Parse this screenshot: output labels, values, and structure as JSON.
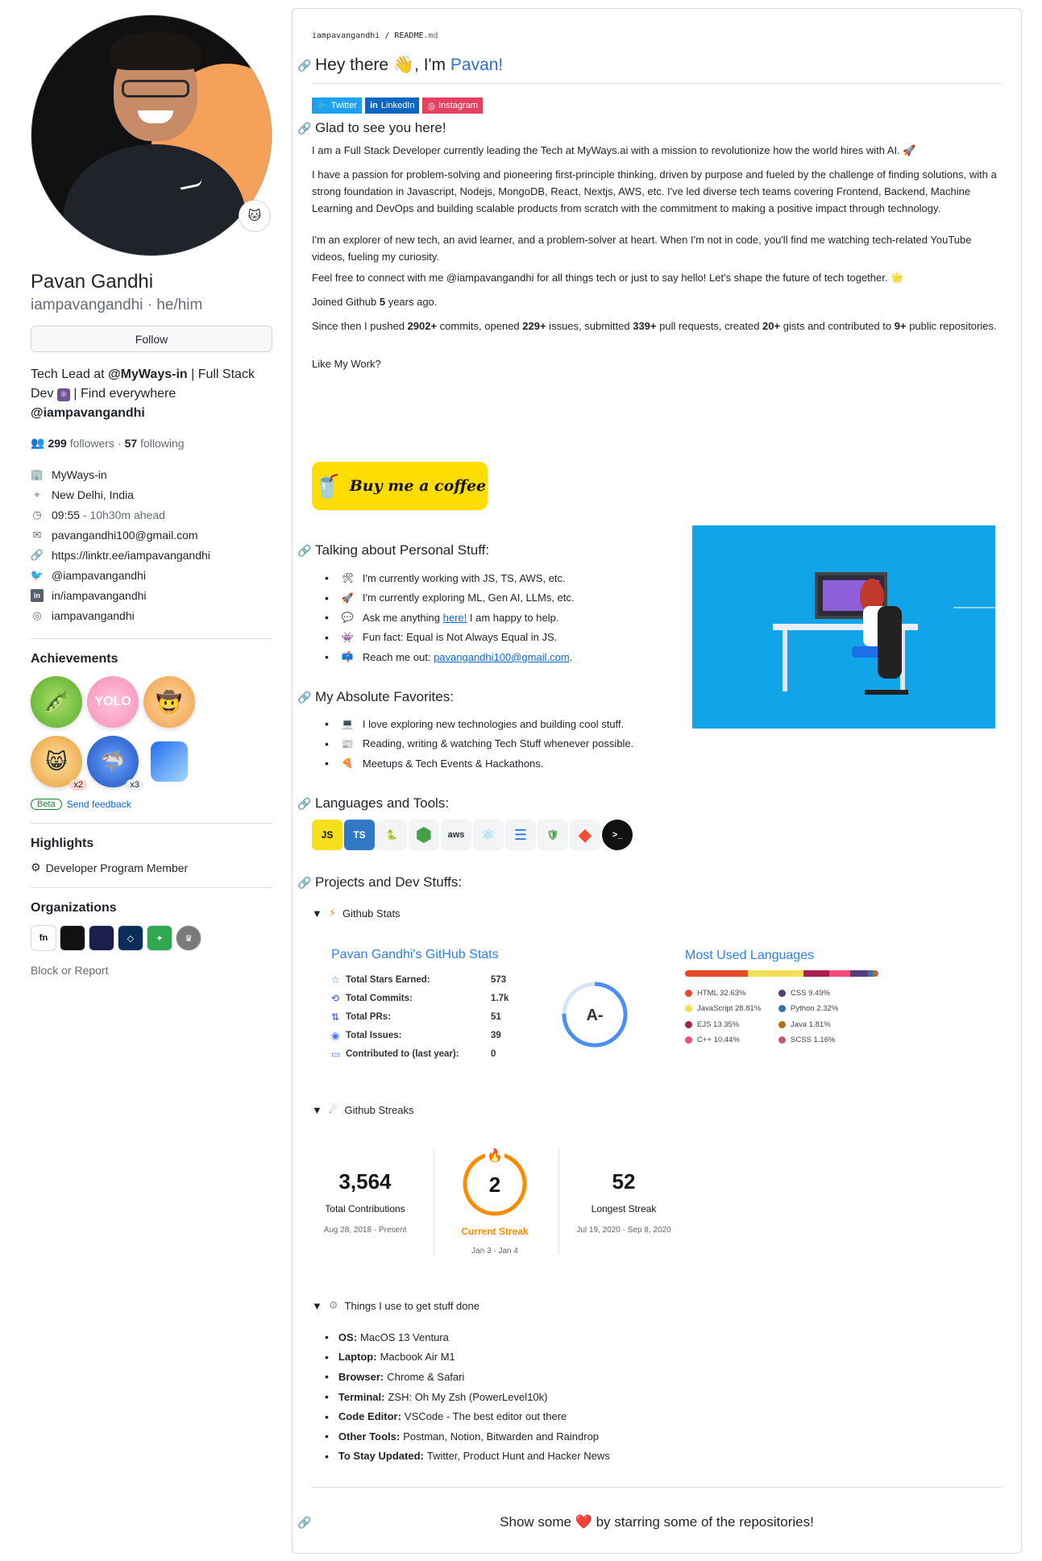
{
  "profile": {
    "name": "Pavan Gandhi",
    "login": "iampavangandhi · he/him",
    "follow_label": "Follow",
    "bio_prefix": "Tech Lead at ",
    "bio_org": "@MyWays-in",
    "bio_mid": " | Full Stack Dev ",
    "bio_mid2": " | Find everywhere ",
    "bio_handle": "@iampavangandhi",
    "followers_count": "299",
    "followers_label": "followers",
    "following_count": "57",
    "following_label": "following",
    "dot": "·",
    "details": [
      {
        "icon": "organization-icon",
        "text": "MyWays-in",
        "muted": ""
      },
      {
        "icon": "location-icon",
        "text": "New Delhi, India",
        "muted": ""
      },
      {
        "icon": "clock-icon",
        "text": "09:55",
        "muted": " - 10h30m ahead"
      },
      {
        "icon": "mail-icon",
        "text": "pavangandhi100@gmail.com",
        "muted": ""
      },
      {
        "icon": "link-icon",
        "text": "https://linktr.ee/iampavangandhi",
        "muted": ""
      },
      {
        "icon": "twitter-icon",
        "text": "@iampavangandhi",
        "muted": ""
      },
      {
        "icon": "linkedin-icon",
        "text": "in/iampavangandhi",
        "muted": ""
      },
      {
        "icon": "instagram-icon",
        "text": "iampavangandhi",
        "muted": ""
      }
    ],
    "achievements_title": "Achievements",
    "achievement_counts": {
      "a4": "x2",
      "a5": "x3"
    },
    "beta_label": "Beta",
    "feedback_label": "Send feedback",
    "highlights_title": "Highlights",
    "highlight_item": "Developer Program Member",
    "orgs_title": "Organizations",
    "block_label": "Block or Report"
  },
  "readme": {
    "crumb_user": "iampavangandhi",
    "crumb_sep": " / ",
    "crumb_file": "README",
    "crumb_ext": ".md",
    "hello_pre": "Hey there ",
    "hello_wave": "👋",
    "hello_mid": ", I'm ",
    "hello_name": "Pavan!",
    "badges": [
      {
        "label": "Twitter",
        "color": "#1da1f2"
      },
      {
        "label": "LinkedIn",
        "color": "#0a66c2"
      },
      {
        "label": "Instagram",
        "color": "#e4405f"
      }
    ],
    "glad_title": "Glad to see you here!",
    "para1": "I am a Full Stack Developer currently leading the Tech at MyWays.ai with a mission to revolutionize how the world hires with AI. 🚀",
    "para2": "I have a passion for problem-solving and pioneering first-principle thinking, driven by purpose and fueled by the challenge of finding solutions, with a strong foundation in Javascript, Nodejs, MongoDB, React, Nextjs, AWS, etc. I've led diverse tech teams covering Frontend, Backend, Machine Learning and DevOps and building scalable products from scratch with the commitment to making a positive impact through technology.",
    "para3": "I'm an explorer of new tech, an avid learner, and a problem-solver at heart. When I'm not in code, you'll find me watching tech-related YouTube videos, fueling my curiosity.",
    "para4": "Feel free to connect with me @iampavangandhi for all things tech or just to say hello! Let's shape the future of tech together. 🌟",
    "joined_pre": "Joined Github ",
    "joined_years": "5",
    "joined_post": " years ago.",
    "since": {
      "t1": "Since then I pushed ",
      "commits": "2902+",
      "t2": " commits, opened ",
      "issues": "229+",
      "t3": " issues, submitted ",
      "prs": "339+",
      "t4": " pull requests, created ",
      "gists": "20+",
      "t5": " gists and contributed to ",
      "repos": "9+",
      "t6": " public repositories."
    },
    "like_work": "Like My Work?",
    "bmc_label": "Buy me a coffee",
    "personal_title": "Talking about Personal Stuff:",
    "personal": [
      {
        "emoji": "🛠",
        "text": "I'm currently working with JS, TS, AWS, etc."
      },
      {
        "emoji": "🚀",
        "text": "I'm currently exploring ML, Gen AI, LLMs, etc."
      },
      {
        "emoji": "💬",
        "text": "Ask me anything ",
        "link": "here!",
        "after": " I am happy to help."
      },
      {
        "emoji": "👾",
        "text": "Fun fact: Equal is Not Always Equal in JS."
      },
      {
        "emoji": "📫",
        "text": "Reach me out: ",
        "link": "pavangandhi100@gmail.com",
        "after": "."
      }
    ],
    "favorites_title": "My Absolute Favorites:",
    "favorites": [
      {
        "emoji": "💻",
        "text": "I love exploring new technologies and building cool stuff."
      },
      {
        "emoji": "📰",
        "text": "Reading, writing & watching Tech Stuff whenever possible."
      },
      {
        "emoji": "🍕",
        "text": "Meetups & Tech Events & Hackathons."
      }
    ],
    "tools_title": "Languages and Tools:",
    "tools": [
      {
        "name": "javascript-icon",
        "glyph": "JS"
      },
      {
        "name": "typescript-icon",
        "glyph": "TS"
      },
      {
        "name": "python-icon",
        "glyph": "🐍"
      },
      {
        "name": "nodejs-icon",
        "glyph": "⬢"
      },
      {
        "name": "aws-icon",
        "glyph": "aws"
      },
      {
        "name": "react-icon",
        "glyph": "⚛"
      },
      {
        "name": "database-icon",
        "glyph": "☰"
      },
      {
        "name": "mongodb-icon",
        "glyph": "🛡"
      },
      {
        "name": "git-icon",
        "glyph": "◆"
      },
      {
        "name": "terminal-icon",
        "glyph": ">_"
      }
    ],
    "projects_title": "Projects and Dev Stuffs:",
    "github_stats_summary": "Github Stats",
    "stats": {
      "title": "Pavan Gandhi's GitHub Stats",
      "rows": [
        {
          "icon": "star-icon",
          "label": "Total Stars Earned:",
          "value": "573"
        },
        {
          "icon": "history-icon",
          "label": "Total Commits:",
          "value": "1.7k"
        },
        {
          "icon": "pr-icon",
          "label": "Total PRs:",
          "value": "51"
        },
        {
          "icon": "issue-icon",
          "label": "Total Issues:",
          "value": "39"
        },
        {
          "icon": "repo-icon",
          "label": "Contributed to (last year):",
          "value": "0"
        }
      ],
      "rank": "A-"
    },
    "languages": {
      "title": "Most Used Languages",
      "items": [
        {
          "name": "HTML 32.63%",
          "pct": 32.63,
          "color": "#e34c26"
        },
        {
          "name": "JavaScript 28.81%",
          "pct": 28.81,
          "color": "#f1e05a"
        },
        {
          "name": "EJS 13.35%",
          "pct": 13.35,
          "color": "#a91e50"
        },
        {
          "name": "C++ 10.44%",
          "pct": 10.44,
          "color": "#f34b7d"
        },
        {
          "name": "CSS 9.49%",
          "pct": 9.49,
          "color": "#563d7c"
        },
        {
          "name": "Python 2.32%",
          "pct": 2.32,
          "color": "#3572a5"
        },
        {
          "name": "Java 1.81%",
          "pct": 1.81,
          "color": "#b07219"
        },
        {
          "name": "SCSS 1.16%",
          "pct": 1.16,
          "color": "#c6538c"
        }
      ]
    },
    "streaks_summary": "Github Streaks",
    "streaks": {
      "total": "3,564",
      "total_label": "Total Contributions",
      "total_range": "Aug 28, 2018 - Present",
      "current": "2",
      "current_label": "Current Streak",
      "current_range": "Jan 3 - Jan 4",
      "longest": "52",
      "longest_label": "Longest Streak",
      "longest_range": "Jul 19, 2020 - Sep 8, 2020",
      "accent": "#fb8c00"
    },
    "things_summary": "Things I use to get stuff done",
    "things": [
      {
        "k": "OS:",
        "v": "MacOS 13 Ventura"
      },
      {
        "k": "Laptop:",
        "v": "Macbook Air M1"
      },
      {
        "k": "Browser:",
        "v": "Chrome & Safari"
      },
      {
        "k": "Terminal:",
        "v": "ZSH: Oh My Zsh (PowerLevel10k)"
      },
      {
        "k": "Code Editor:",
        "v": "VSCode - The best editor out there"
      },
      {
        "k": "Other Tools:",
        "v": "Postman, Notion, Bitwarden and Raindrop"
      },
      {
        "k": "To Stay Updated:",
        "v": "Twitter, Product Hunt and Hacker News"
      }
    ],
    "footer_pre": "Show some ",
    "footer_heart": "❤️",
    "footer_post": " by starring some of the repositories!"
  }
}
